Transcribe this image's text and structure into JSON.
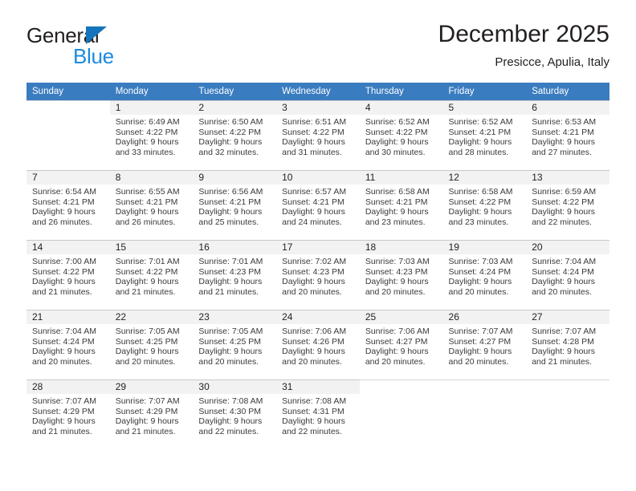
{
  "brand": {
    "name_top": "General",
    "name_bottom": "Blue",
    "triangle_color": "#1574bb",
    "blue_color": "#1b8ae0"
  },
  "header": {
    "title": "December 2025",
    "subtitle": "Presicce, Apulia, Italy"
  },
  "theme": {
    "header_row_bg": "#3a7cc0",
    "header_row_text": "#ffffff",
    "day_number_bg": "#f2f2f2",
    "grid_line": "#c9c9c9"
  },
  "weekday_headers": [
    "Sunday",
    "Monday",
    "Tuesday",
    "Wednesday",
    "Thursday",
    "Friday",
    "Saturday"
  ],
  "weeks": [
    [
      {
        "day": "",
        "sunrise": "",
        "sunset": "",
        "daylight1": "",
        "daylight2": ""
      },
      {
        "day": "1",
        "sunrise": "Sunrise: 6:49 AM",
        "sunset": "Sunset: 4:22 PM",
        "daylight1": "Daylight: 9 hours",
        "daylight2": "and 33 minutes."
      },
      {
        "day": "2",
        "sunrise": "Sunrise: 6:50 AM",
        "sunset": "Sunset: 4:22 PM",
        "daylight1": "Daylight: 9 hours",
        "daylight2": "and 32 minutes."
      },
      {
        "day": "3",
        "sunrise": "Sunrise: 6:51 AM",
        "sunset": "Sunset: 4:22 PM",
        "daylight1": "Daylight: 9 hours",
        "daylight2": "and 31 minutes."
      },
      {
        "day": "4",
        "sunrise": "Sunrise: 6:52 AM",
        "sunset": "Sunset: 4:22 PM",
        "daylight1": "Daylight: 9 hours",
        "daylight2": "and 30 minutes."
      },
      {
        "day": "5",
        "sunrise": "Sunrise: 6:52 AM",
        "sunset": "Sunset: 4:21 PM",
        "daylight1": "Daylight: 9 hours",
        "daylight2": "and 28 minutes."
      },
      {
        "day": "6",
        "sunrise": "Sunrise: 6:53 AM",
        "sunset": "Sunset: 4:21 PM",
        "daylight1": "Daylight: 9 hours",
        "daylight2": "and 27 minutes."
      }
    ],
    [
      {
        "day": "7",
        "sunrise": "Sunrise: 6:54 AM",
        "sunset": "Sunset: 4:21 PM",
        "daylight1": "Daylight: 9 hours",
        "daylight2": "and 26 minutes."
      },
      {
        "day": "8",
        "sunrise": "Sunrise: 6:55 AM",
        "sunset": "Sunset: 4:21 PM",
        "daylight1": "Daylight: 9 hours",
        "daylight2": "and 26 minutes."
      },
      {
        "day": "9",
        "sunrise": "Sunrise: 6:56 AM",
        "sunset": "Sunset: 4:21 PM",
        "daylight1": "Daylight: 9 hours",
        "daylight2": "and 25 minutes."
      },
      {
        "day": "10",
        "sunrise": "Sunrise: 6:57 AM",
        "sunset": "Sunset: 4:21 PM",
        "daylight1": "Daylight: 9 hours",
        "daylight2": "and 24 minutes."
      },
      {
        "day": "11",
        "sunrise": "Sunrise: 6:58 AM",
        "sunset": "Sunset: 4:21 PM",
        "daylight1": "Daylight: 9 hours",
        "daylight2": "and 23 minutes."
      },
      {
        "day": "12",
        "sunrise": "Sunrise: 6:58 AM",
        "sunset": "Sunset: 4:22 PM",
        "daylight1": "Daylight: 9 hours",
        "daylight2": "and 23 minutes."
      },
      {
        "day": "13",
        "sunrise": "Sunrise: 6:59 AM",
        "sunset": "Sunset: 4:22 PM",
        "daylight1": "Daylight: 9 hours",
        "daylight2": "and 22 minutes."
      }
    ],
    [
      {
        "day": "14",
        "sunrise": "Sunrise: 7:00 AM",
        "sunset": "Sunset: 4:22 PM",
        "daylight1": "Daylight: 9 hours",
        "daylight2": "and 21 minutes."
      },
      {
        "day": "15",
        "sunrise": "Sunrise: 7:01 AM",
        "sunset": "Sunset: 4:22 PM",
        "daylight1": "Daylight: 9 hours",
        "daylight2": "and 21 minutes."
      },
      {
        "day": "16",
        "sunrise": "Sunrise: 7:01 AM",
        "sunset": "Sunset: 4:23 PM",
        "daylight1": "Daylight: 9 hours",
        "daylight2": "and 21 minutes."
      },
      {
        "day": "17",
        "sunrise": "Sunrise: 7:02 AM",
        "sunset": "Sunset: 4:23 PM",
        "daylight1": "Daylight: 9 hours",
        "daylight2": "and 20 minutes."
      },
      {
        "day": "18",
        "sunrise": "Sunrise: 7:03 AM",
        "sunset": "Sunset: 4:23 PM",
        "daylight1": "Daylight: 9 hours",
        "daylight2": "and 20 minutes."
      },
      {
        "day": "19",
        "sunrise": "Sunrise: 7:03 AM",
        "sunset": "Sunset: 4:24 PM",
        "daylight1": "Daylight: 9 hours",
        "daylight2": "and 20 minutes."
      },
      {
        "day": "20",
        "sunrise": "Sunrise: 7:04 AM",
        "sunset": "Sunset: 4:24 PM",
        "daylight1": "Daylight: 9 hours",
        "daylight2": "and 20 minutes."
      }
    ],
    [
      {
        "day": "21",
        "sunrise": "Sunrise: 7:04 AM",
        "sunset": "Sunset: 4:24 PM",
        "daylight1": "Daylight: 9 hours",
        "daylight2": "and 20 minutes."
      },
      {
        "day": "22",
        "sunrise": "Sunrise: 7:05 AM",
        "sunset": "Sunset: 4:25 PM",
        "daylight1": "Daylight: 9 hours",
        "daylight2": "and 20 minutes."
      },
      {
        "day": "23",
        "sunrise": "Sunrise: 7:05 AM",
        "sunset": "Sunset: 4:25 PM",
        "daylight1": "Daylight: 9 hours",
        "daylight2": "and 20 minutes."
      },
      {
        "day": "24",
        "sunrise": "Sunrise: 7:06 AM",
        "sunset": "Sunset: 4:26 PM",
        "daylight1": "Daylight: 9 hours",
        "daylight2": "and 20 minutes."
      },
      {
        "day": "25",
        "sunrise": "Sunrise: 7:06 AM",
        "sunset": "Sunset: 4:27 PM",
        "daylight1": "Daylight: 9 hours",
        "daylight2": "and 20 minutes."
      },
      {
        "day": "26",
        "sunrise": "Sunrise: 7:07 AM",
        "sunset": "Sunset: 4:27 PM",
        "daylight1": "Daylight: 9 hours",
        "daylight2": "and 20 minutes."
      },
      {
        "day": "27",
        "sunrise": "Sunrise: 7:07 AM",
        "sunset": "Sunset: 4:28 PM",
        "daylight1": "Daylight: 9 hours",
        "daylight2": "and 21 minutes."
      }
    ],
    [
      {
        "day": "28",
        "sunrise": "Sunrise: 7:07 AM",
        "sunset": "Sunset: 4:29 PM",
        "daylight1": "Daylight: 9 hours",
        "daylight2": "and 21 minutes."
      },
      {
        "day": "29",
        "sunrise": "Sunrise: 7:07 AM",
        "sunset": "Sunset: 4:29 PM",
        "daylight1": "Daylight: 9 hours",
        "daylight2": "and 21 minutes."
      },
      {
        "day": "30",
        "sunrise": "Sunrise: 7:08 AM",
        "sunset": "Sunset: 4:30 PM",
        "daylight1": "Daylight: 9 hours",
        "daylight2": "and 22 minutes."
      },
      {
        "day": "31",
        "sunrise": "Sunrise: 7:08 AM",
        "sunset": "Sunset: 4:31 PM",
        "daylight1": "Daylight: 9 hours",
        "daylight2": "and 22 minutes."
      },
      {
        "day": "",
        "sunrise": "",
        "sunset": "",
        "daylight1": "",
        "daylight2": ""
      },
      {
        "day": "",
        "sunrise": "",
        "sunset": "",
        "daylight1": "",
        "daylight2": ""
      },
      {
        "day": "",
        "sunrise": "",
        "sunset": "",
        "daylight1": "",
        "daylight2": ""
      }
    ]
  ]
}
